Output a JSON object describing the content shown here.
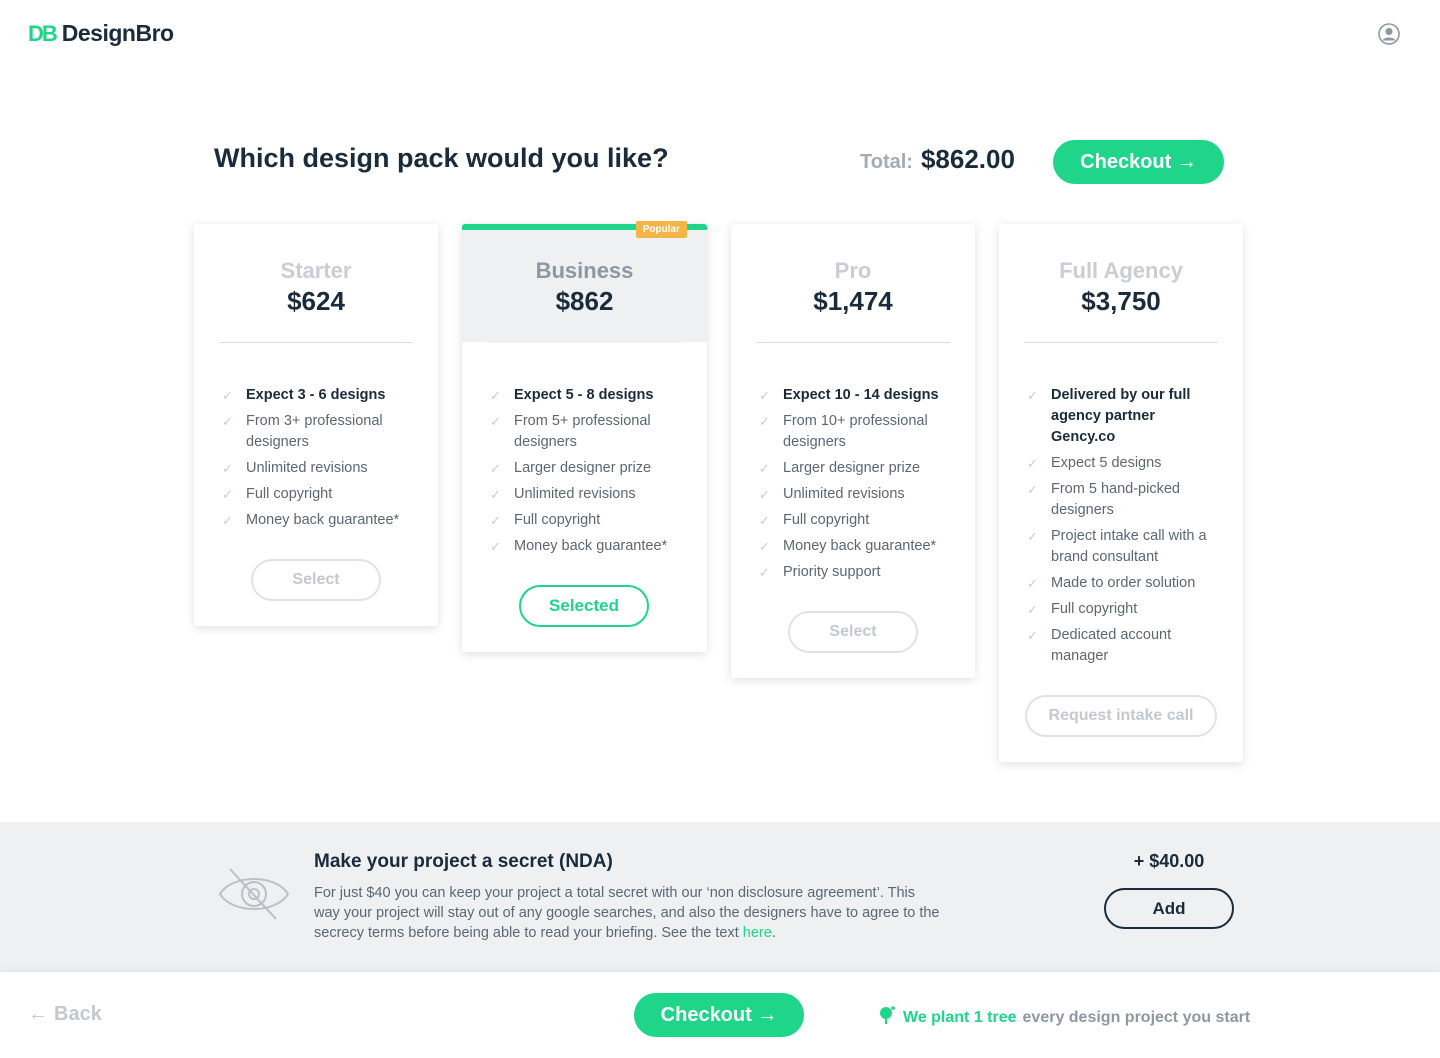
{
  "header": {
    "logo_mark": "DB",
    "logo_text": "DesignBro",
    "avatar_icon": "user-icon"
  },
  "title": "Which design pack would you like?",
  "total": {
    "label": "Total:",
    "value": "$862.00"
  },
  "checkout_label": "Checkout →",
  "colors": {
    "accent": "#1ed58a",
    "popular": "#f5b546",
    "dark": "#1a2b3c"
  },
  "cards": [
    {
      "name": "Starter",
      "price": "$624",
      "features": [
        "Expect 3 - 6 designs",
        "From 3+ professional designers",
        "Unlimited revisions",
        "Full copyright",
        "Money back guarantee*"
      ],
      "button": "Select"
    },
    {
      "name": "Business",
      "price": "$862",
      "badge": "Popular",
      "features": [
        "Expect 5 - 8 designs",
        "From 5+ professional designers",
        "Larger designer prize",
        "Unlimited revisions",
        "Full copyright",
        "Money back guarantee*"
      ],
      "button": "Selected"
    },
    {
      "name": "Pro",
      "price": "$1,474",
      "features": [
        "Expect 10 - 14 designs",
        "From 10+ professional designers",
        "Larger designer prize",
        "Unlimited revisions",
        "Full copyright",
        "Money back guarantee*",
        "Priority support"
      ],
      "button": "Select"
    },
    {
      "name": "Full Agency",
      "price": "$3,750",
      "features": [
        "Delivered by our full agency partner Gency.co",
        "Expect 5 designs",
        "From 5 hand-picked designers",
        "Project intake call with a brand consultant",
        "Made to order solution",
        "Full copyright",
        "Dedicated account manager"
      ],
      "button": "Request intake call"
    }
  ],
  "nda": {
    "title": "Make your project a secret (NDA)",
    "body": "For just $40 you can keep your project a total secret with our ‘non disclosure agreement’. This way your project will stay out of any google searches, and also the designers have to agree to the secrecy terms before being able to read your briefing. See the text ",
    "link": "here",
    "after_link": ".",
    "price": "+ $40.00",
    "button": "Add"
  },
  "footer": {
    "back": "Back",
    "tree_green": "We plant 1 tree",
    "tree_grey": "every design project you start"
  }
}
